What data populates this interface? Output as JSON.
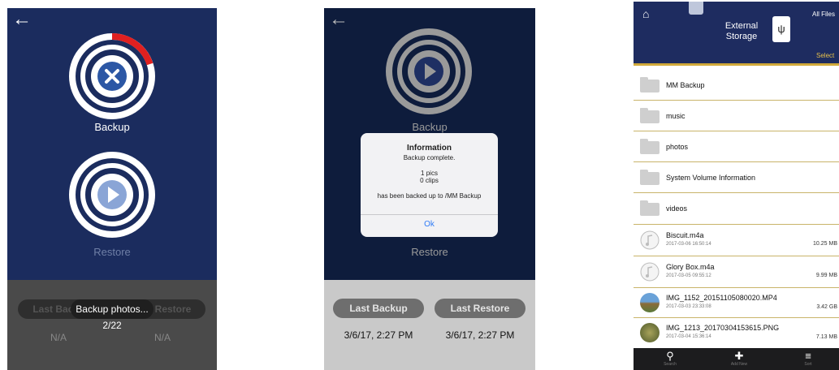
{
  "screen1": {
    "backup_label": "Backup",
    "restore_label": "Restore",
    "last_backup": "Last Backup",
    "last_restore": "Last Restore",
    "na_left": "N/A",
    "na_right": "N/A",
    "toast_title": "Backup photos...",
    "toast_progress": "2/22",
    "progress_fraction": 0.09
  },
  "screen2": {
    "backup_label": "Backup",
    "restore_label": "Restore",
    "dialog": {
      "title": "Information",
      "line1": "Backup complete.",
      "pics": "1 pics",
      "clips": "0 clips",
      "line2": "has been backed up to /MM Backup",
      "ok": "Ok"
    },
    "last_backup": "Last Backup",
    "last_restore": "Last Restore",
    "last_backup_date": "3/6/17, 2:27 PM",
    "last_restore_date": "3/6/17, 2:27 PM"
  },
  "screen3": {
    "header_title": "External\nStorage",
    "all_files": "All Files",
    "select": "Select",
    "folders": [
      "MM Backup",
      "music",
      "photos",
      "System Volume Information",
      "videos"
    ],
    "files": [
      {
        "name": "Biscuit.m4a",
        "date": "2017-03-06 16:50:14",
        "size": "10.25 MB"
      },
      {
        "name": "Glory Box.m4a",
        "date": "2017-03-05 09:55:12",
        "size": "9.99 MB"
      },
      {
        "name": "IMG_1152_20151105080020.MP4",
        "date": "2017-03-03 23:33:08",
        "size": "3.42 GB"
      },
      {
        "name": "IMG_1213_20170304153615.PNG",
        "date": "2017-03-04 15:36:14",
        "size": "7.13 MB"
      }
    ],
    "tabs": [
      "Search",
      "Add New",
      "Sort"
    ]
  },
  "colors": {
    "navy": "#1b2c5e",
    "red": "#e02020",
    "gold": "#d1a93a",
    "blue": "#2c57a5"
  }
}
